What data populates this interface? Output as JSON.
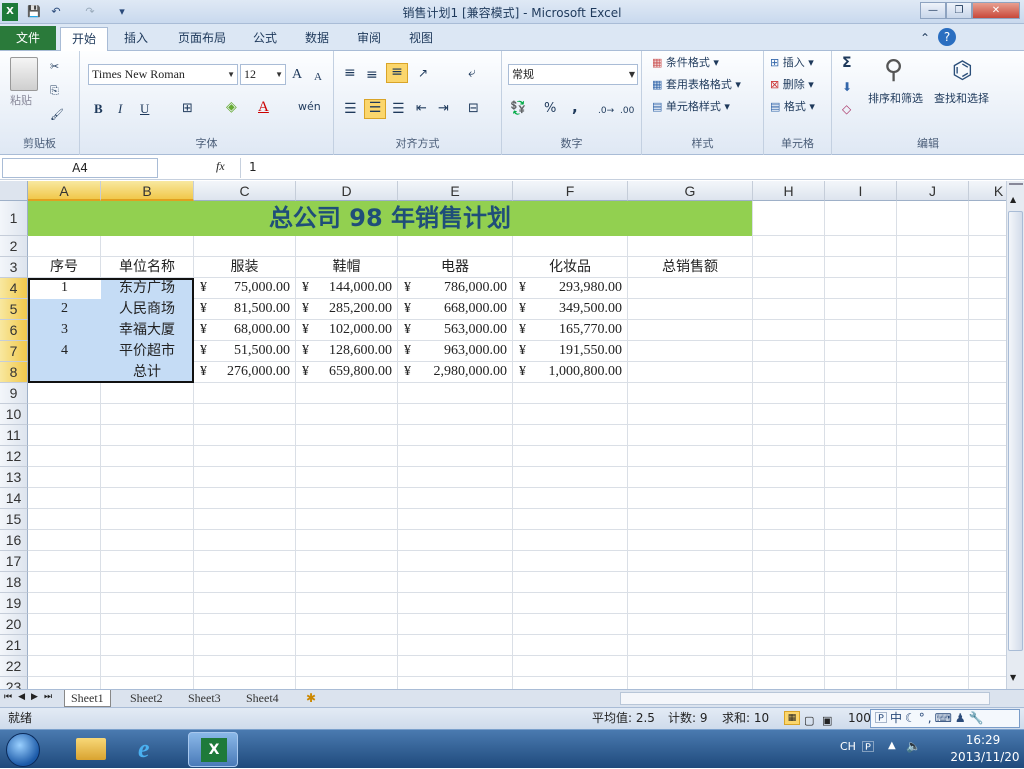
{
  "window": {
    "title": "销售计划1 [兼容模式] - Microsoft Excel",
    "minimize": "—",
    "restore": "❐",
    "close": "✕",
    "qat": [
      "💾",
      "↶",
      "↷",
      "▾"
    ]
  },
  "ribbon_tabs": {
    "file": "文件",
    "items": [
      "开始",
      "插入",
      "页面布局",
      "公式",
      "数据",
      "审阅",
      "视图"
    ]
  },
  "ribbon": {
    "clipboard": {
      "label": "剪贴板",
      "paste": "粘贴"
    },
    "font": {
      "label": "字体",
      "name": "Times New Roman",
      "size": "12",
      "bold": "B",
      "italic": "I",
      "underline": "U",
      "grow": "A",
      "shrink": "A"
    },
    "alignment": {
      "label": "对齐方式"
    },
    "number": {
      "label": "数字",
      "format": "常规",
      "percent": "%",
      "comma": ","
    },
    "styles": {
      "label": "样式",
      "conditional": "条件格式",
      "table": "套用表格格式",
      "cell": "单元格样式"
    },
    "cells": {
      "label": "单元格",
      "insert": "插入",
      "delete": "删除",
      "format": "格式"
    },
    "editing": {
      "label": "编辑",
      "sort": "排序和筛选",
      "find": "查找和选择",
      "sum": "Σ"
    }
  },
  "formula_bar": {
    "name_box": "A4",
    "fx": "fx",
    "value": "1"
  },
  "columns": [
    "A",
    "B",
    "C",
    "D",
    "E",
    "F",
    "G",
    "H",
    "I",
    "J",
    "K"
  ],
  "rows": [
    "1",
    "2",
    "3",
    "4",
    "5",
    "6",
    "7",
    "8",
    "9",
    "10",
    "11",
    "12",
    "13",
    "14",
    "15",
    "16",
    "17",
    "18",
    "19",
    "20",
    "21",
    "22",
    "23"
  ],
  "sheet": {
    "title": "总公司 98 年销售计划",
    "headers": [
      "序号",
      "单位名称",
      "服装",
      "鞋帽",
      "电器",
      "化妆品",
      "总销售额"
    ],
    "currency": "¥",
    "rows": [
      {
        "no": "1",
        "unit": "东方广场",
        "c": "75,000.00",
        "d": "144,000.00",
        "e": "786,000.00",
        "f": "293,980.00"
      },
      {
        "no": "2",
        "unit": "人民商场",
        "c": "81,500.00",
        "d": "285,200.00",
        "e": "668,000.00",
        "f": "349,500.00"
      },
      {
        "no": "3",
        "unit": "幸福大厦",
        "c": "68,000.00",
        "d": "102,000.00",
        "e": "563,000.00",
        "f": "165,770.00"
      },
      {
        "no": "4",
        "unit": "平价超市",
        "c": "51,500.00",
        "d": "128,600.00",
        "e": "963,000.00",
        "f": "191,550.00"
      }
    ],
    "total": {
      "unit": "总计",
      "c": "276,000.00",
      "d": "659,800.00",
      "e": "2,980,000.00",
      "f": "1,000,800.00"
    }
  },
  "sheet_tabs": [
    "Sheet1",
    "Sheet2",
    "Sheet3",
    "Sheet4"
  ],
  "status": {
    "ready": "就绪",
    "average": "平均值: 2.5",
    "count": "计数: 9",
    "sum": "求和: 10",
    "zoom": "100"
  },
  "taskbar": {
    "lang": "CH",
    "ime": "中",
    "time": "16:29",
    "date": "2013/11/20"
  },
  "colors": {
    "title_fill": "#92d050",
    "title_text": "#1f4e79",
    "selection": "#c5dcf5",
    "accent": "#2a7a3a"
  }
}
